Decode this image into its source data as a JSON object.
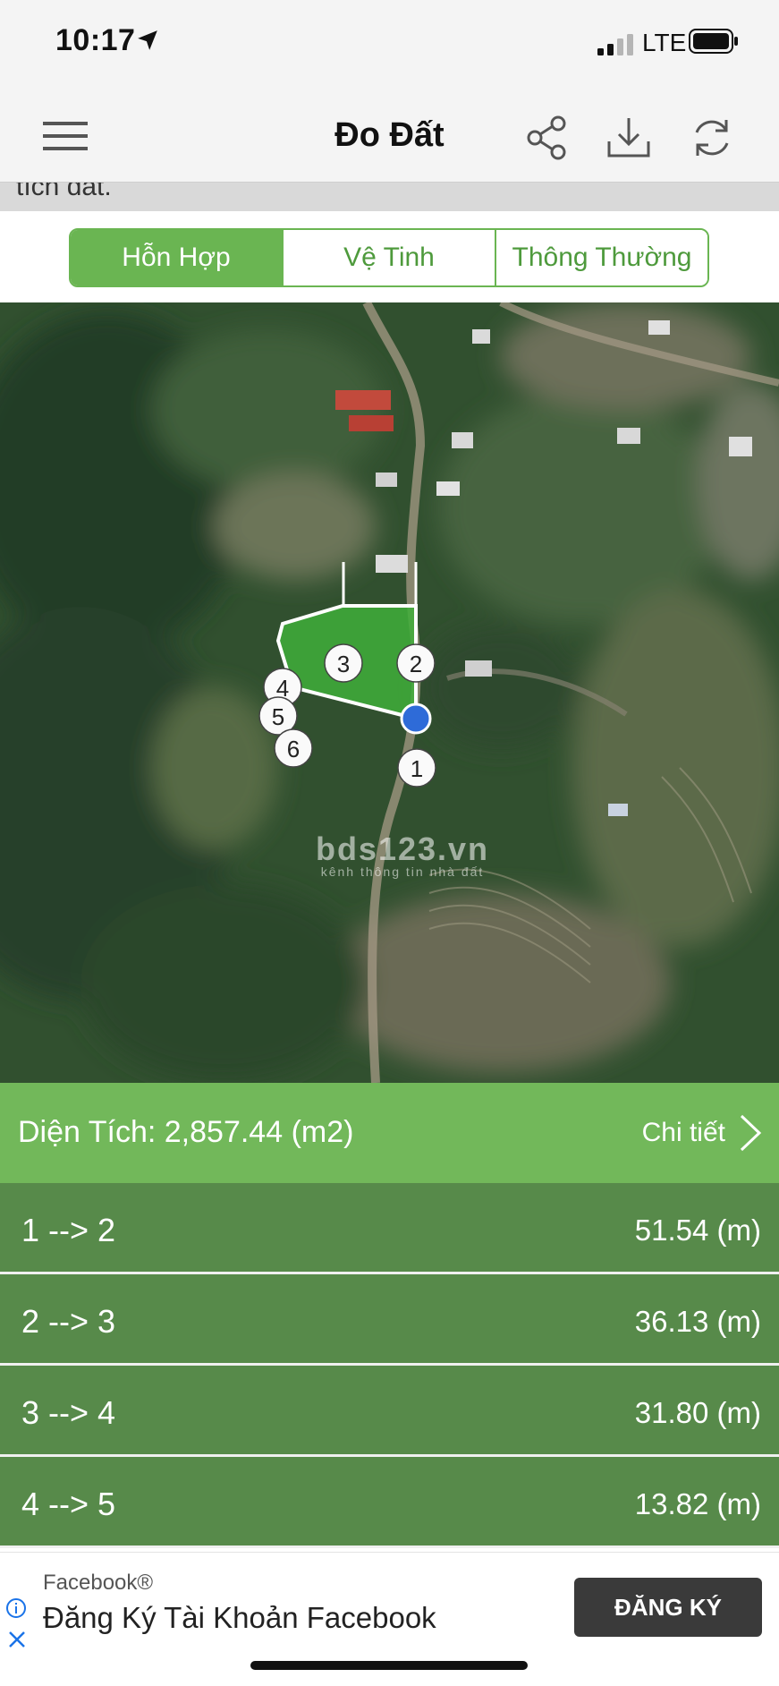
{
  "status_bar": {
    "time": "10:17",
    "network": "LTE"
  },
  "nav": {
    "title": "Đo Đất",
    "icons": [
      "menu-icon",
      "share-icon",
      "download-icon",
      "refresh-icon"
    ]
  },
  "peek_text": "tích đất.",
  "map_types": {
    "tabs": [
      {
        "label": "Hỗn Hợp",
        "active": true
      },
      {
        "label": "Vệ Tinh",
        "active": false
      },
      {
        "label": "Thông Thường",
        "active": false
      }
    ]
  },
  "map": {
    "markers": [
      "1",
      "2",
      "3",
      "4",
      "5",
      "6"
    ],
    "watermark_main": "bds123.vn",
    "watermark_sub": "kênh thông tin nhà đất",
    "polygon_color": "#3fae3a"
  },
  "area": {
    "text": "Diện Tích: 2,857.44 (m2)",
    "detail_label": "Chi tiết"
  },
  "segments": [
    {
      "label": "1 --> 2",
      "value": "51.54 (m)"
    },
    {
      "label": "2 --> 3",
      "value": "36.13 (m)"
    },
    {
      "label": "3 --> 4",
      "value": "31.80 (m)"
    },
    {
      "label": "4 --> 5",
      "value": "13.82 (m)"
    }
  ],
  "ad": {
    "brand": "Facebook®",
    "title": "Đăng Ký Tài Khoản Facebook",
    "cta": "ĐĂNG KÝ"
  },
  "colors": {
    "accent_green": "#72b85a",
    "row_green": "#578a4a",
    "ad_button": "#3a3a3a"
  }
}
